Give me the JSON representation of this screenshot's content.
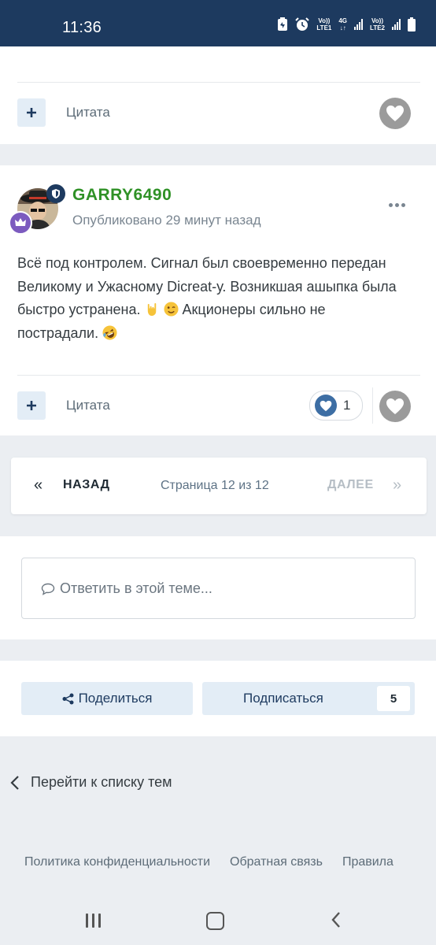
{
  "status_bar": {
    "time": "11:36",
    "net1_top": "Vo))",
    "net1_bottom": "LTE1",
    "net2_top": "4G",
    "net2_bottom": "↓↑",
    "net3_top": "Vo))",
    "net3_bottom": "LTE2",
    "icons": [
      "battery-saver-icon",
      "alarm-icon",
      "signal-icon",
      "battery-icon"
    ]
  },
  "top_card": {
    "plus_icon": "plus-icon",
    "quote_label": "Цитата",
    "heart_icon": "heart-icon"
  },
  "post": {
    "author": "GARRY6490",
    "published": "Опубликовано 29 минут назад",
    "body_lines": [
      "Всё под контролем. Сигнал был своевременно передан",
      "Великому и Ужасному Dicreat-у. Возникшая ашыпка была",
      "быстро устранена.",
      "Акционеры сильно не",
      "пострадали."
    ],
    "quote_label": "Цитата",
    "reaction_count": "1",
    "colors": {
      "author": "#2f9126",
      "reaction": "#3d6ea4"
    }
  },
  "pager": {
    "prev_label": "НАЗАД",
    "prev_arrow": "«",
    "pages_label": "Страница 12 из 12",
    "next_label": "ДАЛЕЕ",
    "next_arrow": "»"
  },
  "reply": {
    "placeholder": "Ответить в этой теме..."
  },
  "actions": {
    "share_label": "Поделиться",
    "subscribe_label": "Подписаться",
    "subscribe_count": "5"
  },
  "back_link": {
    "label": "Перейти к списку тем"
  },
  "footer": {
    "links": [
      "Политика конфиденциальности",
      "Обратная связь",
      "Правила"
    ]
  },
  "nav_bar": {
    "icons": [
      "recents-icon",
      "home-icon",
      "back-icon"
    ]
  }
}
